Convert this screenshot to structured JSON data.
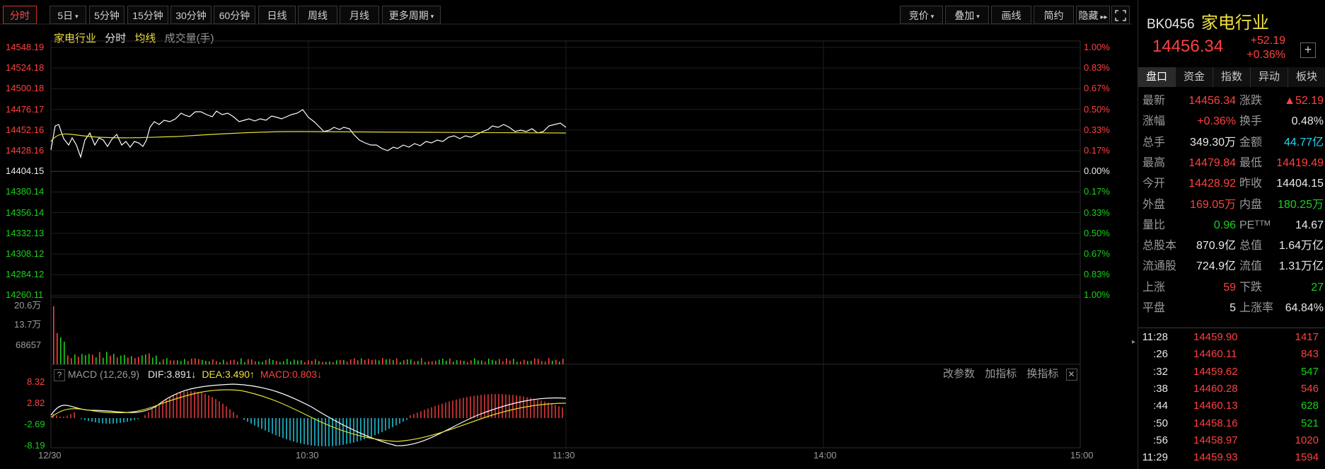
{
  "toolbar": {
    "left": [
      {
        "label": "分时",
        "active": true
      },
      {
        "label": "5日",
        "dropdown": true
      },
      {
        "label": "5分钟"
      },
      {
        "label": "15分钟"
      },
      {
        "label": "30分钟"
      },
      {
        "label": "60分钟"
      },
      {
        "label": "日线"
      },
      {
        "label": "周线"
      },
      {
        "label": "月线"
      },
      {
        "label": "更多周期",
        "dropdown": true
      }
    ],
    "right": [
      {
        "label": "竞价",
        "dropdown": true
      },
      {
        "label": "叠加",
        "dropdown": true
      },
      {
        "label": "画线"
      },
      {
        "label": "简约"
      },
      {
        "label": "隐藏",
        "suffix": "▸▸"
      }
    ]
  },
  "legend": {
    "name": "家电行业",
    "mode": "分时",
    "avg": "均线",
    "volume": "成交量(手)"
  },
  "price_axis": {
    "left": [
      "14548.19",
      "14524.18",
      "14500.18",
      "14476.17",
      "14452.16",
      "14428.16",
      "14404.15",
      "14380.14",
      "14356.14",
      "14332.13",
      "14308.12",
      "14284.12",
      "14260.11"
    ],
    "right": [
      "1.00%",
      "0.83%",
      "0.67%",
      "0.50%",
      "0.33%",
      "0.17%",
      "0.00%",
      "0.17%",
      "0.33%",
      "0.50%",
      "0.67%",
      "0.83%",
      "1.00%"
    ]
  },
  "volume_axis": [
    "20.6万",
    "13.7万",
    "68657"
  ],
  "macd": {
    "title": "MACD (12,26,9)",
    "dif": "DIF:3.891↓",
    "dea": "DEA:3.490↑",
    "macd": "MACD:0.803↓",
    "axis": [
      "8.32",
      "2.82",
      "-2.69",
      "-8.19"
    ],
    "actions": [
      "改参数",
      "加指标",
      "换指标"
    ]
  },
  "time_axis": [
    "12/30",
    "10:30",
    "11:30",
    "14:00",
    "15:00"
  ],
  "colors": {
    "up": "#ff4040",
    "down": "#19d219",
    "price_line": "#ffffff",
    "avg_line": "#e8e030",
    "cyan": "#20d8f0"
  },
  "quote": {
    "code": "BK0456",
    "name": "家电行业",
    "price": "14456.34",
    "change": "+52.19",
    "pct": "+0.36%",
    "tabs": [
      "盘口",
      "资金",
      "指数",
      "异动",
      "板块"
    ],
    "rows": [
      {
        "l1": "最新",
        "v1": "14456.34",
        "c1": "red",
        "l2": "涨跌",
        "v2": "▲52.19",
        "c2": "red"
      },
      {
        "l1": "涨幅",
        "v1": "+0.36%",
        "c1": "red",
        "l2": "换手",
        "v2": "0.48%",
        "c2": "wht"
      },
      {
        "l1": "总手",
        "v1": "349.30万",
        "c1": "wht",
        "l2": "金额",
        "v2": "44.77亿",
        "c2": "cyn"
      },
      {
        "l1": "最高",
        "v1": "14479.84",
        "c1": "red",
        "l2": "最低",
        "v2": "14419.49",
        "c2": "red"
      },
      {
        "l1": "今开",
        "v1": "14428.92",
        "c1": "red",
        "l2": "昨收",
        "v2": "14404.15",
        "c2": "wht"
      },
      {
        "l1": "外盘",
        "v1": "169.05万",
        "c1": "red",
        "l2": "内盘",
        "v2": "180.25万",
        "c2": "grn"
      },
      {
        "l1": "量比",
        "v1": "0.96",
        "c1": "grn",
        "l2": "PEᵀᵀᴹ",
        "v2": "14.67",
        "c2": "wht"
      },
      {
        "l1": "总股本",
        "v1": "870.9亿",
        "c1": "wht",
        "l2": "总值",
        "v2": "1.64万亿",
        "c2": "wht"
      },
      {
        "l1": "流通股",
        "v1": "724.9亿",
        "c1": "wht",
        "l2": "流值",
        "v2": "1.31万亿",
        "c2": "wht"
      },
      {
        "l1": "上涨",
        "v1": "59",
        "c1": "red",
        "l2": "下跌",
        "v2": "27",
        "c2": "grn"
      },
      {
        "l1": "平盘",
        "v1": "5",
        "c1": "wht",
        "l2": "上涨率",
        "v2": "64.84%",
        "c2": "wht"
      }
    ],
    "ticks": [
      {
        "t": "11:28",
        "p": "14459.90",
        "v": "1417",
        "vc": "red"
      },
      {
        "t": ":26",
        "p": "14460.11",
        "v": "843",
        "vc": "red"
      },
      {
        "t": ":32",
        "p": "14459.62",
        "v": "547",
        "vc": "grn"
      },
      {
        "t": ":38",
        "p": "14460.28",
        "v": "546",
        "vc": "red"
      },
      {
        "t": ":44",
        "p": "14460.13",
        "v": "628",
        "vc": "grn"
      },
      {
        "t": ":50",
        "p": "14458.16",
        "v": "521",
        "vc": "grn"
      },
      {
        "t": ":56",
        "p": "14458.97",
        "v": "1020",
        "vc": "red"
      },
      {
        "t": "11:29",
        "p": "14459.93",
        "v": "1594",
        "vc": "red"
      }
    ]
  }
}
